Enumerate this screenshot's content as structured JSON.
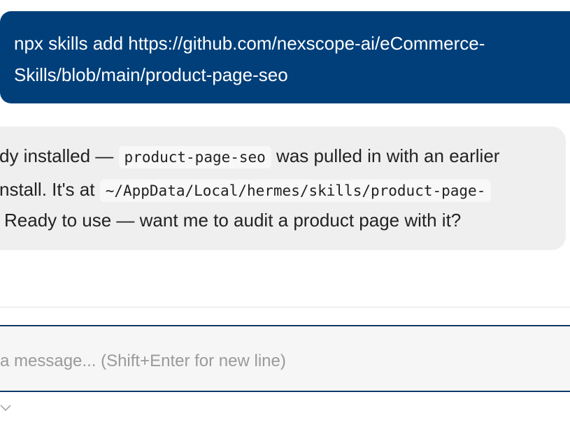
{
  "user_message": {
    "line1": "npx skills add https://github.com/nexscope-ai/eCommerce-",
    "line2": "Skills/blob/main/product-page-seo"
  },
  "assistant_message": {
    "line1_pre": "dy installed — ",
    "line1_code": "product-page-seo",
    "line1_post": " was pulled in with an earlier",
    "line2_pre": "nstall. It's at ",
    "line2_code": "~/AppData/Local/hermes/skills/product-page-",
    "line3": "Ready to use — want me to audit a product page with it?"
  },
  "composer": {
    "placeholder": "a message... (Shift+Enter for new line)"
  },
  "icons": {
    "chevron": "chevron-down-icon"
  }
}
